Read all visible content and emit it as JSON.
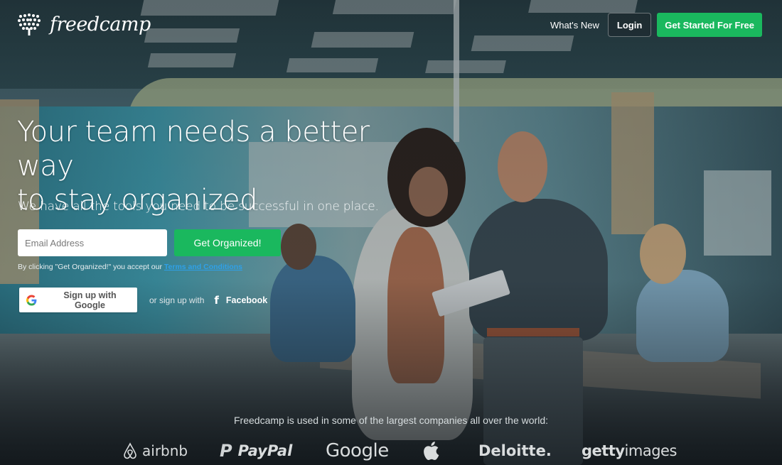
{
  "brand": {
    "name": "freedcamp",
    "logo_icon": "tree-icon"
  },
  "nav": {
    "whats_new": "What's New",
    "login": "Login",
    "get_started": "Get Started For Free"
  },
  "hero": {
    "title_line1": "Your team needs a better way",
    "title_line2": "to stay organized",
    "subtitle": "We have all the tools you need to be successful in one place.",
    "email_placeholder": "Email Address",
    "email_value": "",
    "cta_button": "Get Organized!",
    "terms_prefix": "By clicking \"Get Organized!\" you accept our ",
    "terms_link": "Terms and Conditions",
    "google_button": "Sign up with Google",
    "google_icon": "google-g-icon",
    "or_text": "or sign up with",
    "facebook_button": "Facebook",
    "facebook_icon": "facebook-f-icon",
    "facebook_glyph": "f"
  },
  "companies": {
    "caption": "Freedcamp is used in some of the largest companies all over the world:",
    "logos": [
      {
        "name": "airbnb",
        "text": "airbnb"
      },
      {
        "name": "paypal",
        "text": "PayPal",
        "mark": "P"
      },
      {
        "name": "google",
        "text": "Google"
      },
      {
        "name": "apple",
        "text": ""
      },
      {
        "name": "deloitte",
        "text": "Deloitte."
      },
      {
        "name": "getty",
        "text_bold": "getty",
        "text_light": "images"
      }
    ]
  },
  "colors": {
    "primary_green": "#1ab85e",
    "link_blue": "#2fa0e8",
    "text_white": "#ffffff"
  }
}
